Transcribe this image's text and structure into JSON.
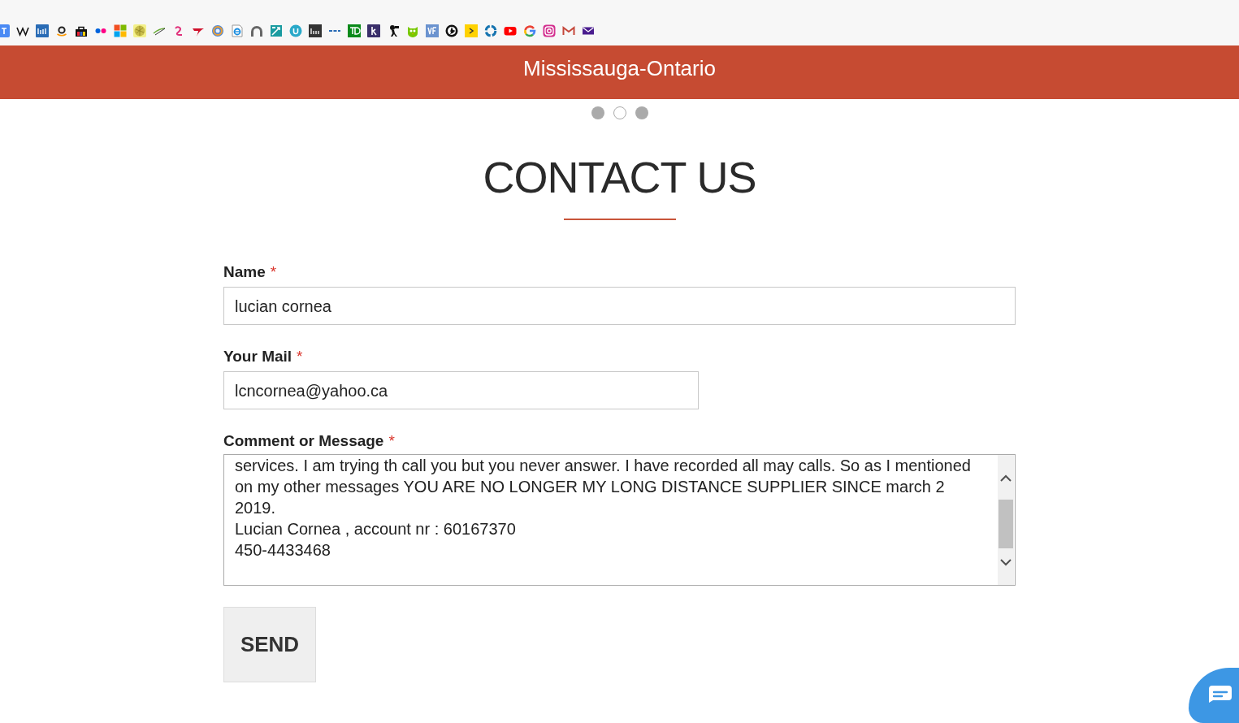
{
  "header": {
    "title": "Mississauga-Ontario"
  },
  "carousel_dots": [
    {
      "selected": false
    },
    {
      "selected": true
    },
    {
      "selected": false
    }
  ],
  "heading": "CONTACT US",
  "form": {
    "fields": [
      {
        "kind": "text",
        "label": "Name",
        "required_mark": "*",
        "value": "lucian cornea"
      },
      {
        "kind": "email",
        "label": "Your Mail",
        "required_mark": "*",
        "value": "lcncornea@yahoo.ca"
      },
      {
        "kind": "textarea",
        "label": "Comment or Message",
        "required_mark": "*",
        "value_lines": [
          "services. I am trying th call you but you never answer. I have recorded all may calls. So as I mentioned",
          "on my other messages YOU ARE NO LONGER MY LONG DISTANCE SUPPLIER SINCE march 2",
          "2019.",
          "Lucian Cornea , account nr : 60167370",
          "450-4433468"
        ]
      }
    ],
    "send_button": "SEND"
  }
}
